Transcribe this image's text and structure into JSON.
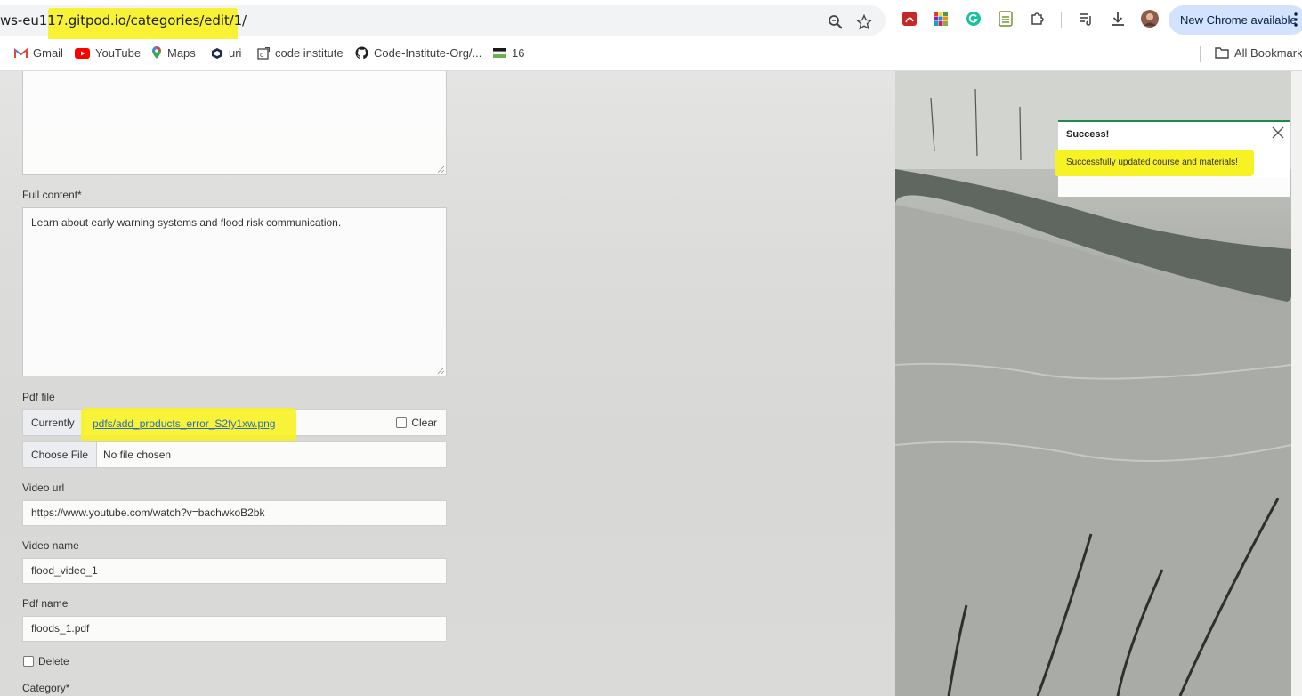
{
  "browser": {
    "url": "ws-eu117.gitpod.io/categories/edit/1/",
    "new_chrome_label": "New Chrome available",
    "bookmarks": [
      {
        "label": "Gmail",
        "icon": "gmail-icon"
      },
      {
        "label": "YouTube",
        "icon": "youtube-icon"
      },
      {
        "label": "Maps",
        "icon": "maps-icon"
      },
      {
        "label": "uri",
        "icon": "cube-icon"
      },
      {
        "label": "code institute",
        "icon": "code-institute-icon"
      },
      {
        "label": "Code-Institute-Org/...",
        "icon": "github-icon"
      },
      {
        "label": "16",
        "icon": "flag-icon"
      }
    ],
    "all_bookmarks_label": "All Bookmarks"
  },
  "form": {
    "full_content": {
      "label": "Full content*",
      "value": "Learn about early warning systems and flood risk communication."
    },
    "pdf_file": {
      "label": "Pdf file",
      "currently_label": "Currently",
      "current_file": "pdfs/add_products_error_S2fy1xw.png",
      "clear_label": "Clear",
      "choose_label": "Choose File",
      "no_file_label": "No file chosen"
    },
    "video_url": {
      "label": "Video url",
      "value": "https://www.youtube.com/watch?v=bachwkoB2bk"
    },
    "video_name": {
      "label": "Video name",
      "value": "flood_video_1"
    },
    "pdf_name": {
      "label": "Pdf name",
      "value": "floods_1.pdf"
    },
    "delete_label": "Delete",
    "category_label": "Category*"
  },
  "toast": {
    "title": "Success!",
    "message": "Successfully updated course and materials!"
  },
  "colors": {
    "highlight": "#f7f224",
    "success": "#1e8a4c",
    "link": "#2a6cba"
  }
}
